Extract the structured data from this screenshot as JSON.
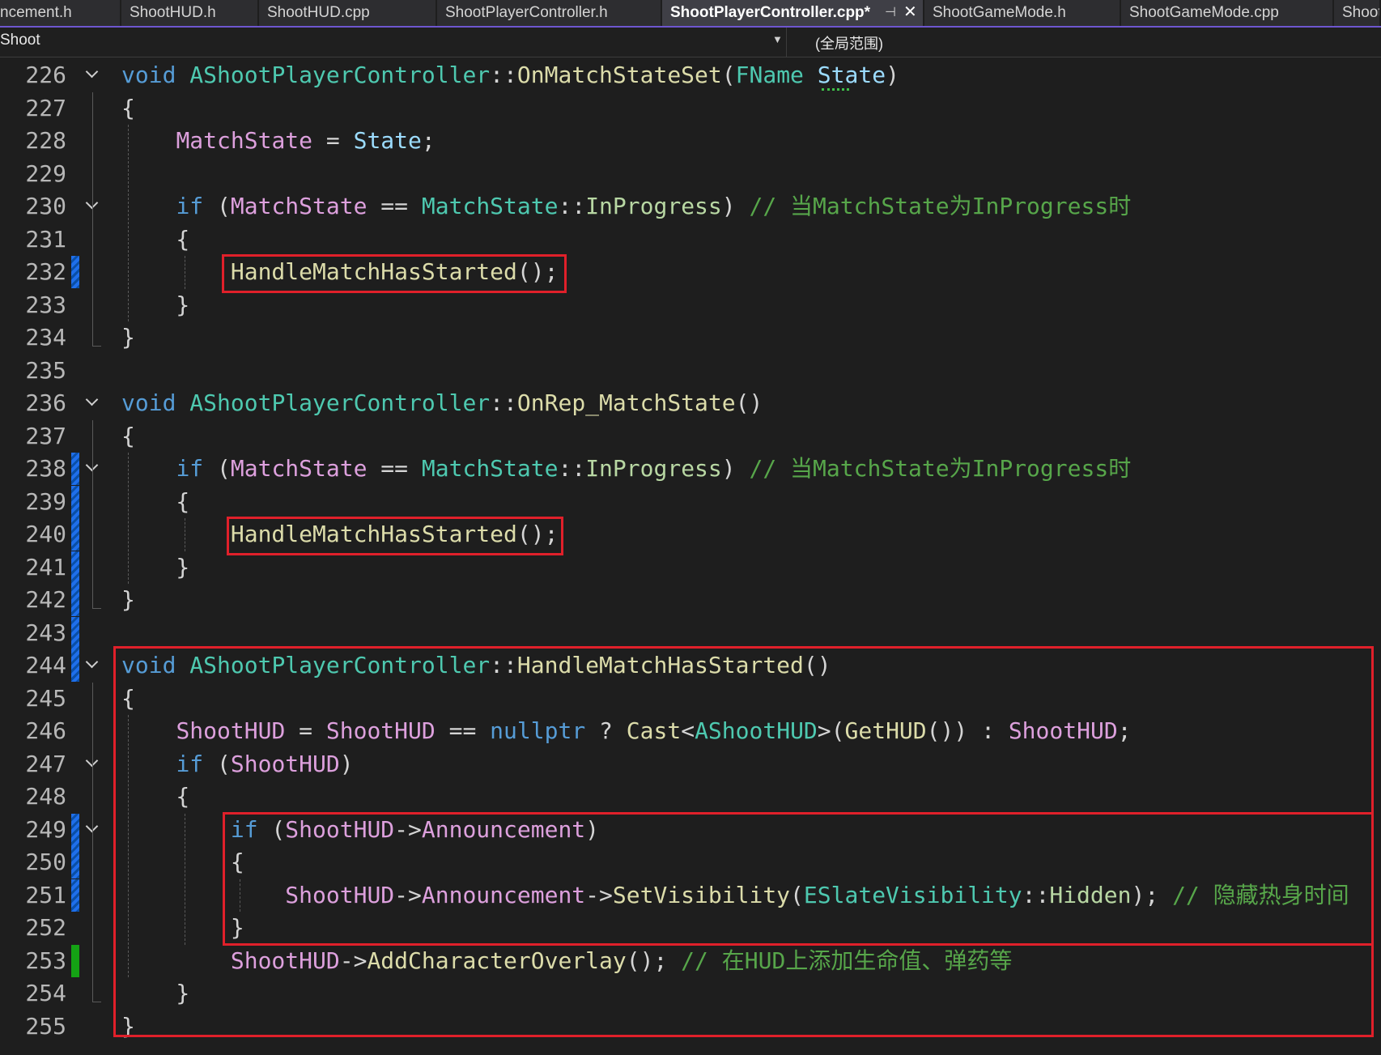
{
  "tabs": [
    {
      "label": "ncement.h"
    },
    {
      "label": "ShootHUD.h"
    },
    {
      "label": "ShootHUD.cpp"
    },
    {
      "label": "ShootPlayerController.h"
    },
    {
      "label": "ShootPlayerController.cpp*",
      "active": true,
      "pin_icon": "pin-icon",
      "close_icon": "close-icon"
    },
    {
      "label": "ShootGameMode.h"
    },
    {
      "label": "ShootGameMode.cpp"
    },
    {
      "label": "Shoot"
    }
  ],
  "nav": {
    "project": "Shoot",
    "scope": "(全局范围)"
  },
  "colors": {
    "keyword": "#569cd6",
    "type": "#4ec9b0",
    "function": "#dcdcaa",
    "member": "#dda0dd",
    "parameter": "#9cdcfe",
    "comment": "#57a64a",
    "highlight_box": "#e0202a",
    "change_saved": "#1f6feb",
    "change_unsaved": "#14a214"
  },
  "code_lines": [
    {
      "num": "226",
      "fold": true,
      "tokens": [
        [
          "kw",
          "void"
        ],
        [
          "op",
          " "
        ],
        [
          "ty",
          "AShootPlayerController"
        ],
        [
          "op",
          "::"
        ],
        [
          "fn",
          "OnMatchStateSet"
        ],
        [
          "op",
          "("
        ],
        [
          "ty",
          "FName"
        ],
        [
          "op",
          " "
        ],
        [
          "prm",
          "State"
        ],
        [
          "op",
          ")"
        ]
      ]
    },
    {
      "num": "227",
      "tokens": [
        [
          "op",
          "{"
        ]
      ]
    },
    {
      "num": "228",
      "tokens": [
        [
          "op",
          "    "
        ],
        [
          "mem",
          "MatchState"
        ],
        [
          "op",
          " = "
        ],
        [
          "prm",
          "State"
        ],
        [
          "op",
          ";"
        ]
      ]
    },
    {
      "num": "229",
      "tokens": []
    },
    {
      "num": "230",
      "fold": true,
      "tokens": [
        [
          "op",
          "    "
        ],
        [
          "kw",
          "if"
        ],
        [
          "op",
          " ("
        ],
        [
          "mem",
          "MatchState"
        ],
        [
          "op",
          " == "
        ],
        [
          "ty",
          "MatchState"
        ],
        [
          "op",
          "::"
        ],
        [
          "enm",
          "InProgress"
        ],
        [
          "op",
          ") "
        ],
        [
          "cm",
          "// 当MatchState为InProgress时"
        ]
      ]
    },
    {
      "num": "231",
      "tokens": [
        [
          "op",
          "    {"
        ]
      ]
    },
    {
      "num": "232",
      "change": "saved",
      "tokens": [
        [
          "op",
          "        "
        ],
        [
          "fn",
          "HandleMatchHasStarted"
        ],
        [
          "op",
          "();"
        ]
      ]
    },
    {
      "num": "233",
      "tokens": [
        [
          "op",
          "    }"
        ]
      ]
    },
    {
      "num": "234",
      "tokens": [
        [
          "op",
          "}"
        ]
      ]
    },
    {
      "num": "235",
      "tokens": []
    },
    {
      "num": "236",
      "fold": true,
      "tokens": [
        [
          "kw",
          "void"
        ],
        [
          "op",
          " "
        ],
        [
          "ty",
          "AShootPlayerController"
        ],
        [
          "op",
          "::"
        ],
        [
          "fn",
          "OnRep_MatchState"
        ],
        [
          "op",
          "()"
        ]
      ]
    },
    {
      "num": "237",
      "tokens": [
        [
          "op",
          "{"
        ]
      ]
    },
    {
      "num": "238",
      "fold": true,
      "change": "saved",
      "tokens": [
        [
          "op",
          "    "
        ],
        [
          "kw",
          "if"
        ],
        [
          "op",
          " ("
        ],
        [
          "mem",
          "MatchState"
        ],
        [
          "op",
          " == "
        ],
        [
          "ty",
          "MatchState"
        ],
        [
          "op",
          "::"
        ],
        [
          "enm",
          "InProgress"
        ],
        [
          "op",
          ") "
        ],
        [
          "cm",
          "// 当MatchState为InProgress时"
        ]
      ]
    },
    {
      "num": "239",
      "change": "saved",
      "tokens": [
        [
          "op",
          "    {"
        ]
      ]
    },
    {
      "num": "240",
      "change": "saved",
      "tokens": [
        [
          "op",
          "        "
        ],
        [
          "fn",
          "HandleMatchHasStarted"
        ],
        [
          "op",
          "();"
        ]
      ]
    },
    {
      "num": "241",
      "change": "saved",
      "tokens": [
        [
          "op",
          "    }"
        ]
      ]
    },
    {
      "num": "242",
      "change": "saved",
      "tokens": [
        [
          "op",
          "}"
        ]
      ]
    },
    {
      "num": "243",
      "change": "saved",
      "tokens": []
    },
    {
      "num": "244",
      "fold": true,
      "change": "saved",
      "tokens": [
        [
          "kw",
          "void"
        ],
        [
          "op",
          " "
        ],
        [
          "ty",
          "AShootPlayerController"
        ],
        [
          "op",
          "::"
        ],
        [
          "fn",
          "HandleMatchHasStarted"
        ],
        [
          "op",
          "()"
        ]
      ]
    },
    {
      "num": "245",
      "tokens": [
        [
          "op",
          "{"
        ]
      ]
    },
    {
      "num": "246",
      "tokens": [
        [
          "op",
          "    "
        ],
        [
          "mem",
          "ShootHUD"
        ],
        [
          "op",
          " = "
        ],
        [
          "mem",
          "ShootHUD"
        ],
        [
          "op",
          " == "
        ],
        [
          "kw",
          "nullptr"
        ],
        [
          "op",
          " ? "
        ],
        [
          "fn",
          "Cast"
        ],
        [
          "op",
          "<"
        ],
        [
          "ty",
          "AShootHUD"
        ],
        [
          "op",
          ">("
        ],
        [
          "fn",
          "GetHUD"
        ],
        [
          "op",
          "()) : "
        ],
        [
          "mem",
          "ShootHUD"
        ],
        [
          "op",
          ";"
        ]
      ]
    },
    {
      "num": "247",
      "fold": true,
      "tokens": [
        [
          "op",
          "    "
        ],
        [
          "kw",
          "if"
        ],
        [
          "op",
          " ("
        ],
        [
          "mem",
          "ShootHUD"
        ],
        [
          "op",
          ")"
        ]
      ]
    },
    {
      "num": "248",
      "tokens": [
        [
          "op",
          "    {"
        ]
      ]
    },
    {
      "num": "249",
      "fold": true,
      "change": "saved",
      "tokens": [
        [
          "op",
          "        "
        ],
        [
          "kw",
          "if"
        ],
        [
          "op",
          " ("
        ],
        [
          "mem",
          "ShootHUD"
        ],
        [
          "op",
          "->"
        ],
        [
          "mem",
          "Announcement"
        ],
        [
          "op",
          ")"
        ]
      ]
    },
    {
      "num": "250",
      "change": "saved",
      "tokens": [
        [
          "op",
          "        {"
        ]
      ]
    },
    {
      "num": "251",
      "change": "saved",
      "tokens": [
        [
          "op",
          "            "
        ],
        [
          "mem",
          "ShootHUD"
        ],
        [
          "op",
          "->"
        ],
        [
          "mem",
          "Announcement"
        ],
        [
          "op",
          "->"
        ],
        [
          "fn",
          "SetVisibility"
        ],
        [
          "op",
          "("
        ],
        [
          "ty",
          "ESlateVisibility"
        ],
        [
          "op",
          "::"
        ],
        [
          "enm",
          "Hidden"
        ],
        [
          "op",
          "); "
        ],
        [
          "cm",
          "// 隐藏热身时间"
        ]
      ]
    },
    {
      "num": "252",
      "tokens": [
        [
          "op",
          "        }"
        ]
      ]
    },
    {
      "num": "253",
      "change": "unsaved",
      "tokens": [
        [
          "op",
          "        "
        ],
        [
          "mem",
          "ShootHUD"
        ],
        [
          "op",
          "->"
        ],
        [
          "fn",
          "AddCharacterOverlay"
        ],
        [
          "op",
          "(); "
        ],
        [
          "cm",
          "// 在HUD上添加生命值、弹药等"
        ]
      ]
    },
    {
      "num": "254",
      "tokens": [
        [
          "op",
          "    }"
        ]
      ]
    },
    {
      "num": "255",
      "tokens": [
        [
          "op",
          "}"
        ]
      ]
    }
  ]
}
